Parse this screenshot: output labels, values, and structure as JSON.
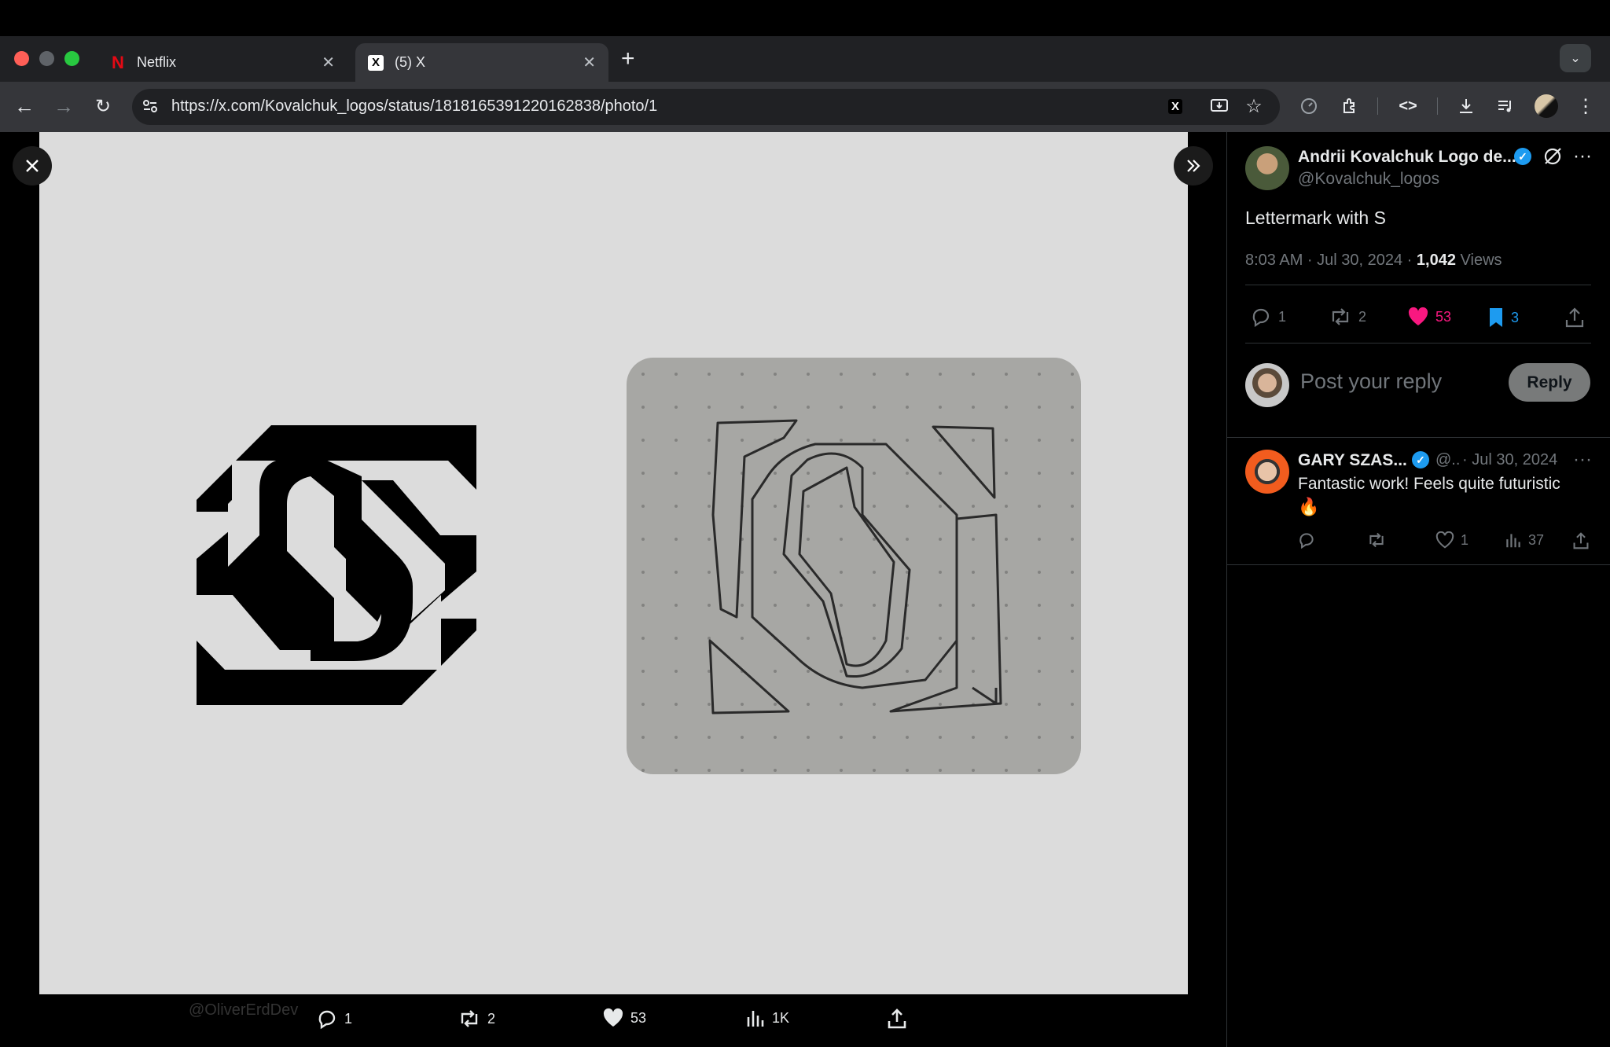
{
  "browser": {
    "tabs": [
      {
        "title": "Netflix",
        "favicon": "N"
      },
      {
        "title": "(5) X",
        "favicon": "X"
      }
    ],
    "url": "https://x.com/Kovalchuk_logos/status/1818165391220162838/photo/1"
  },
  "viewer": {
    "actions": {
      "replies": "1",
      "reposts": "2",
      "likes": "53",
      "views": "1K"
    },
    "background_text": {
      "handle": "@OliverErdDev"
    }
  },
  "post": {
    "author_name": "Andrii Kovalchuk Logo de...",
    "author_handle": "@Kovalchuk_logos",
    "text": "Lettermark with S",
    "time": "8:03 AM · Jul 30, 2024 ·",
    "views_count": "1,042",
    "views_label": "Views",
    "stats": {
      "replies": "1",
      "reposts": "2",
      "likes": "53",
      "bookmarks": "3"
    }
  },
  "composer": {
    "placeholder": "Post your reply",
    "button": "Reply"
  },
  "reply": {
    "author_name": "GARY SZAS...",
    "author_handle": "@..",
    "date": "· Jul 30, 2024",
    "text": "Fantastic work! Feels quite futuristic",
    "emoji": "🔥",
    "stats": {
      "likes": "1",
      "views": "37"
    }
  },
  "colors": {
    "like": "#f91880",
    "bookmark": "#1d9bf0",
    "verified": "#1d9bf0"
  }
}
